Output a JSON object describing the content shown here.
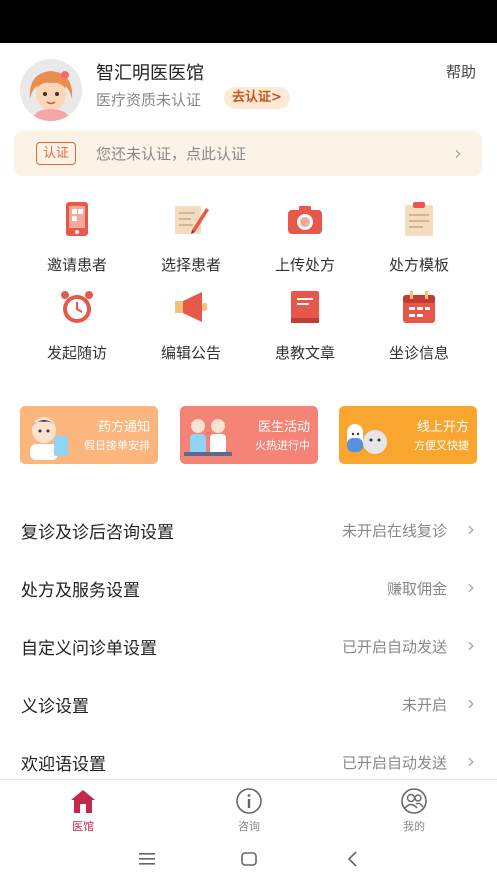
{
  "header": {
    "clinic_name": "智汇明医医馆",
    "help_label": "帮助",
    "qualification_status": "医疗资质未认证",
    "qualification_action": "去认证>"
  },
  "cert_banner": {
    "tag": "认证",
    "text": "您还未认证，点此认证"
  },
  "features": [
    {
      "label": "邀请患者",
      "icon": "phone-icon"
    },
    {
      "label": "选择患者",
      "icon": "edit-icon"
    },
    {
      "label": "上传处方",
      "icon": "camera-icon"
    },
    {
      "label": "处方模板",
      "icon": "clipboard-icon"
    },
    {
      "label": "发起随访",
      "icon": "alarm-clock-icon"
    },
    {
      "label": "编辑公告",
      "icon": "megaphone-icon"
    },
    {
      "label": "患教文章",
      "icon": "book-icon"
    },
    {
      "label": "坐诊信息",
      "icon": "calendar-icon"
    }
  ],
  "promos": [
    {
      "title": "药方通知",
      "subtitle": "假日接单安排",
      "color": "#fbb57d"
    },
    {
      "title": "医生活动",
      "subtitle": "火热进行中",
      "color": "#f58476"
    },
    {
      "title": "线上开方",
      "subtitle": "方便又快捷",
      "color": "#f9a630"
    }
  ],
  "settings": [
    {
      "label": "复诊及诊后咨询设置",
      "status": "未开启在线复诊"
    },
    {
      "label": "处方及服务设置",
      "status": "赚取佣金"
    },
    {
      "label": "自定义问诊单设置",
      "status": "已开启自动发送"
    },
    {
      "label": "义诊设置",
      "status": "未开启"
    },
    {
      "label": "欢迎语设置",
      "status": "已开启自动发送"
    }
  ],
  "tabs": [
    {
      "label": "医馆",
      "icon": "home-icon",
      "active": true
    },
    {
      "label": "咨询",
      "icon": "info-icon",
      "active": false
    },
    {
      "label": "我的",
      "icon": "user-icon",
      "active": false
    }
  ],
  "colors": {
    "accent": "#c2294a",
    "cert_orange": "#e2673d",
    "icon_red": "#e8584a",
    "banner_bg": "#fbf4e6"
  }
}
